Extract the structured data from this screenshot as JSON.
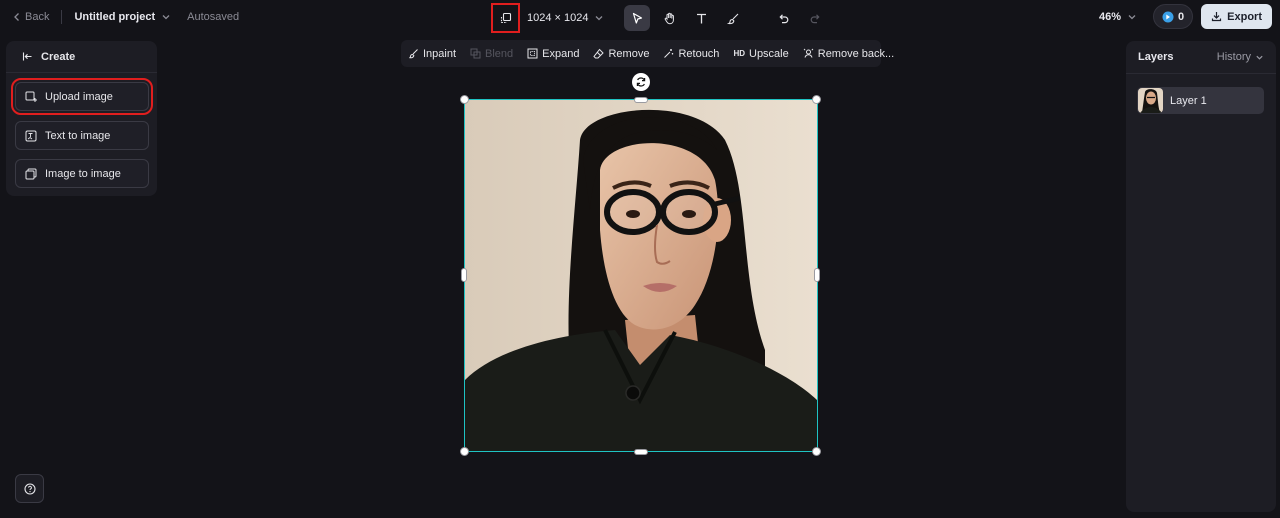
{
  "topbar": {
    "back_label": "Back",
    "project_name": "Untitled project",
    "autosave_status": "Autosaved",
    "canvas_size": "1024 × 1024",
    "zoom": "46%",
    "credits": "0",
    "export_label": "Export"
  },
  "create_panel": {
    "header": "Create",
    "options": [
      "Upload image",
      "Text to image",
      "Image to image"
    ]
  },
  "context_toolbar": {
    "items": [
      {
        "label": "Inpaint",
        "icon": "brush-icon",
        "enabled": true
      },
      {
        "label": "Blend",
        "icon": "blend-icon",
        "enabled": false
      },
      {
        "label": "Expand",
        "icon": "expand-icon",
        "enabled": true
      },
      {
        "label": "Remove",
        "icon": "eraser-icon",
        "enabled": true
      },
      {
        "label": "Retouch",
        "icon": "magic-wand-icon",
        "enabled": true
      },
      {
        "label": "Upscale",
        "icon": "hd-icon",
        "badge": "HD",
        "enabled": true
      },
      {
        "label": "Remove back...",
        "icon": "remove-background-icon",
        "enabled": true
      }
    ]
  },
  "layers_panel": {
    "title": "Layers",
    "history_label": "History",
    "layers": [
      "Layer 1"
    ]
  },
  "colors": {
    "background": "#131318",
    "panel": "#1d1d24",
    "selection": "#1fc3c3",
    "highlight": "#e01e1e",
    "export_bg": "#dfe6ef",
    "credit_accent": "#3aa0e8"
  }
}
